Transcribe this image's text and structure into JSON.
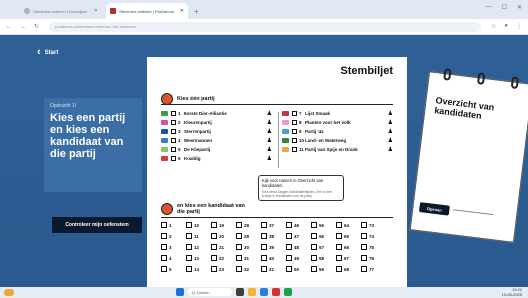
{
  "browser": {
    "tabs": [
      {
        "label": "Stemmen oefenen | Kieswijzer",
        "active": false
      },
      {
        "label": "Stemmen oefenen | ProDemos",
        "active": true
      }
    ],
    "url": "prodemos.nl/stemmen/oefenen-met-stemmen"
  },
  "page": {
    "start_label": "Start",
    "exercise_label": "Opdracht 1/",
    "exercise_title": "Kies een partij en kies een kandidaat van die partij",
    "check_button": "Controleer mijn oefenstem"
  },
  "ballot": {
    "title": "Stembiljet",
    "section1": "Kies één partij",
    "section2": "en kies een kandidaat van die partij",
    "parties_left": [
      {
        "num": "1",
        "name": "Eerste Dier-Alliantie",
        "color": "#3a9b3f"
      },
      {
        "num": "2",
        "name": "Kleurenpartij",
        "color": "#d94fa0"
      },
      {
        "num": "3",
        "name": "Sterrenpartij",
        "color": "#1f4fa8"
      },
      {
        "num": "4",
        "name": "Weermannen",
        "color": "#3d7bbd"
      },
      {
        "num": "5",
        "name": "De Kliepartij",
        "color": "#8ac36b"
      },
      {
        "num": "6",
        "name": "Knaldig",
        "color": "#d43b3b"
      }
    ],
    "parties_right": [
      {
        "num": "7",
        "name": "Lijst Smaak",
        "color": "#c2324a"
      },
      {
        "num": "8",
        "name": "Planten voor het volk",
        "color": "#e59bd1"
      },
      {
        "num": "9",
        "name": "Partij '4x",
        "color": "#3aa3d9"
      },
      {
        "num": "10",
        "name": "Land- en Waterweg",
        "color": "#3e7c4a"
      },
      {
        "num": "11",
        "name": "Partij van Spijs en Drank",
        "color": "#f0a53a"
      },
      {
        "num": "12",
        "name": "",
        "color": "#ffffff"
      }
    ],
    "tip_title": "Kijk voor namen in Overzicht van kandidaten",
    "tip_text": "Kies eerst Jaagen Kandidatenlijsten. Zet nu een kruisje in Kandidaten van de partij",
    "candidates": [
      "1",
      "10",
      "19",
      "28",
      "37",
      "46",
      "55",
      "64",
      "73",
      "2",
      "11",
      "20",
      "29",
      "38",
      "47",
      "56",
      "65",
      "74",
      "3",
      "12",
      "21",
      "30",
      "39",
      "48",
      "57",
      "66",
      "75",
      "4",
      "13",
      "22",
      "31",
      "40",
      "49",
      "58",
      "67",
      "76",
      "5",
      "14",
      "23",
      "32",
      "41",
      "50",
      "59",
      "68",
      "77"
    ]
  },
  "card": {
    "title": "Overzicht van kandidaten",
    "open_button": "Openen"
  },
  "taskbar": {
    "search": "Q Zoeken",
    "time": "13:22",
    "date": "13-05-2025"
  }
}
